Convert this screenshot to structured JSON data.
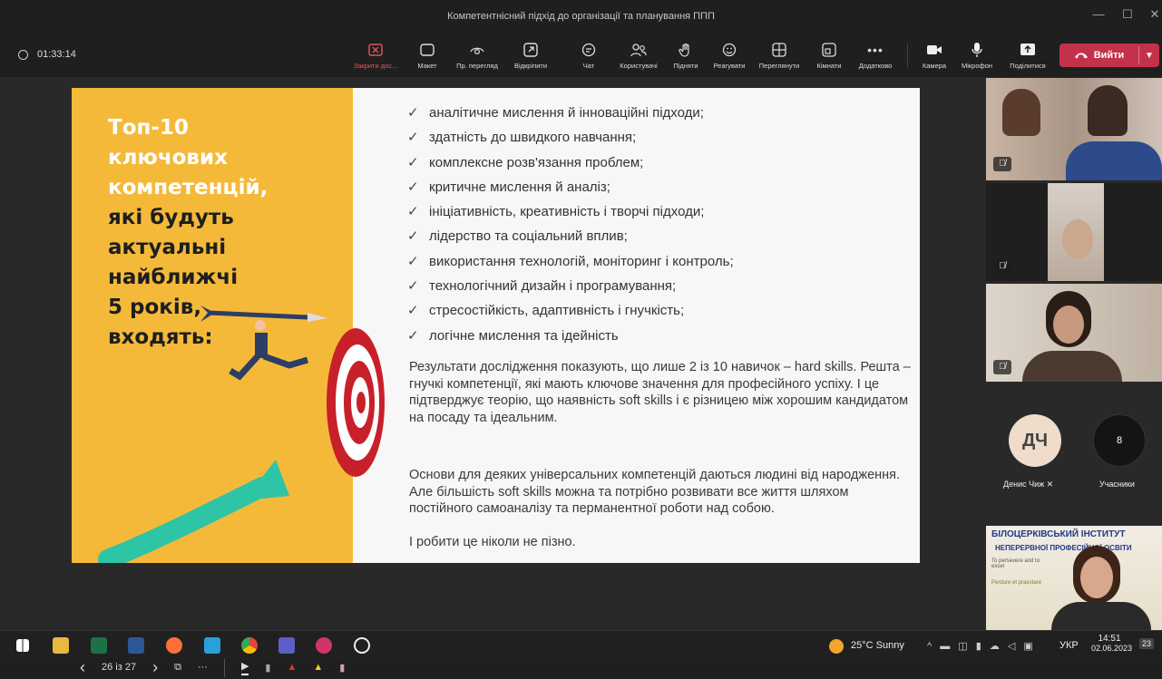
{
  "window": {
    "title": "Компетентнісний підхід до організації та планування ППП",
    "min": "—",
    "max": "☐",
    "close": "✕"
  },
  "toolbar": {
    "timer": "01:33:14",
    "buttons": [
      {
        "label": "Закрити дос..."
      },
      {
        "label": "Макет"
      },
      {
        "label": "Пр. перегляд"
      },
      {
        "label": "Відкріпити"
      },
      {
        "label": "Чат"
      },
      {
        "label": "Користувачі"
      },
      {
        "label": "Підняти"
      },
      {
        "label": "Реагувати"
      },
      {
        "label": "Переглянути"
      },
      {
        "label": "Кімнати"
      },
      {
        "label": "Додатково"
      },
      {
        "label": "Камера"
      },
      {
        "label": "Мікрофон"
      },
      {
        "label": "Поділитися"
      }
    ],
    "leave_label": "Вийти"
  },
  "slide": {
    "heading_white": [
      "Топ-10",
      "ключових",
      "компетенцій,"
    ],
    "heading_dark": [
      "які будуть",
      "актуальні",
      "найближчі",
      "5 років,",
      "входять:"
    ],
    "bullets": [
      "аналітичне мислення й інноваційні підходи;",
      "здатність до швидкого навчання;",
      "комплексне розв'язання проблем;",
      "критичне мислення й аналіз;",
      "ініціативність, креативність і творчі підходи;",
      "лідерство та соціальний вплив;",
      "використання технологій, моніторинг і контроль;",
      "технологічний дизайн і програмування;",
      "стресостійкість, адаптивність і гнучкість;",
      "логічне мислення та ідейність"
    ],
    "para1": "Результати дослідження показують, що лише 2 із 10 навичок – hard skills. Решта – гнучкі компетенції, які мають ключове значення для професійного успіху. І це підтверджує теорію, що наявність soft skills і є різницею між хорошим кандидатом на посаду та ідеальним.",
    "para2": "Основи для деяких універсальних компетенцій даються людині від народження. Але більшість soft skills можна та потрібно розвивати все життя шляхом постійного самоаналізу та перманентної роботи над собою.",
    "para3": "І робити це ніколи не пізно."
  },
  "slide_controls": {
    "counter": "26 із 27",
    "prev": "‹",
    "next": "›",
    "more": "···"
  },
  "participants": {
    "denys_initials": "ДЧ",
    "denys_name": "Денис Чиж",
    "count": "8",
    "count_label": "Учасники",
    "banner_line1": "БІЛОЦЕРКІВСЬКИЙ ІНСТИТУТ",
    "banner_line2": "НЕПЕРЕРВНОЇ ПРОФЕСІЙНОЇ ОСВІТИ",
    "banner_motto1": "To persevere and to excel",
    "banner_motto2": "Perdure et praestare"
  },
  "taskbar": {
    "weather": "25°C Sunny",
    "lang": "УКР",
    "time": "14:51",
    "date": "02.06.2023",
    "badge": "23"
  },
  "colors": {
    "slide_yellow": "#f5b93a",
    "leave_red": "#c4314b",
    "teams_bg": "#1f1f1f"
  }
}
